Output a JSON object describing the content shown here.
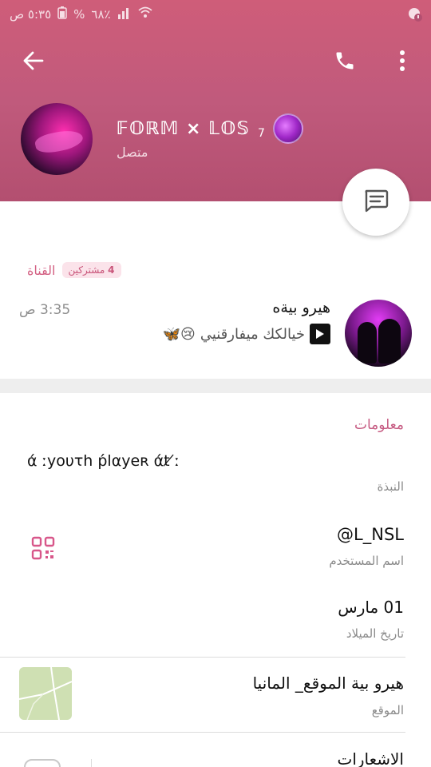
{
  "status_bar": {
    "time": "٥:٣٥ ص",
    "battery": "٦٨٪",
    "battery_symbol": "%"
  },
  "header": {
    "title": "𝔽𝕆ℝ𝕄 × 𝕃𝕆𝕊",
    "subscript": "7",
    "status": "متصل"
  },
  "channel": {
    "label": "القناة",
    "subscribers_count": "4",
    "subscribers_label": "مشتركين"
  },
  "chat": {
    "name": "هيرو بيةه",
    "time": "3:35 ص",
    "message": "خيالكك ميفارقنيي",
    "emojis": "😢🦋"
  },
  "info": {
    "section_title": "معلومات",
    "bio": "ά ːyoυτh ṕlαyeʀ άt ̸ː",
    "bio_label": "النبذة",
    "username": "@L_NSL",
    "username_label": "اسم المستخدم",
    "birthday": "01 مارس",
    "birthday_label": "تاريخ الميلاد",
    "location": "هيرو بية الموقع_ المانيا",
    "location_label": "الموقع",
    "notifications": "الاشعارات"
  },
  "colors": {
    "header_top": "#cf5d79",
    "header_bottom": "#b34f70",
    "accent": "#c65b82"
  },
  "icons": [
    "back-arrow-icon",
    "phone-icon",
    "more-vert-icon",
    "message-icon",
    "play-icon",
    "qr-code-icon",
    "map-thumbnail"
  ]
}
